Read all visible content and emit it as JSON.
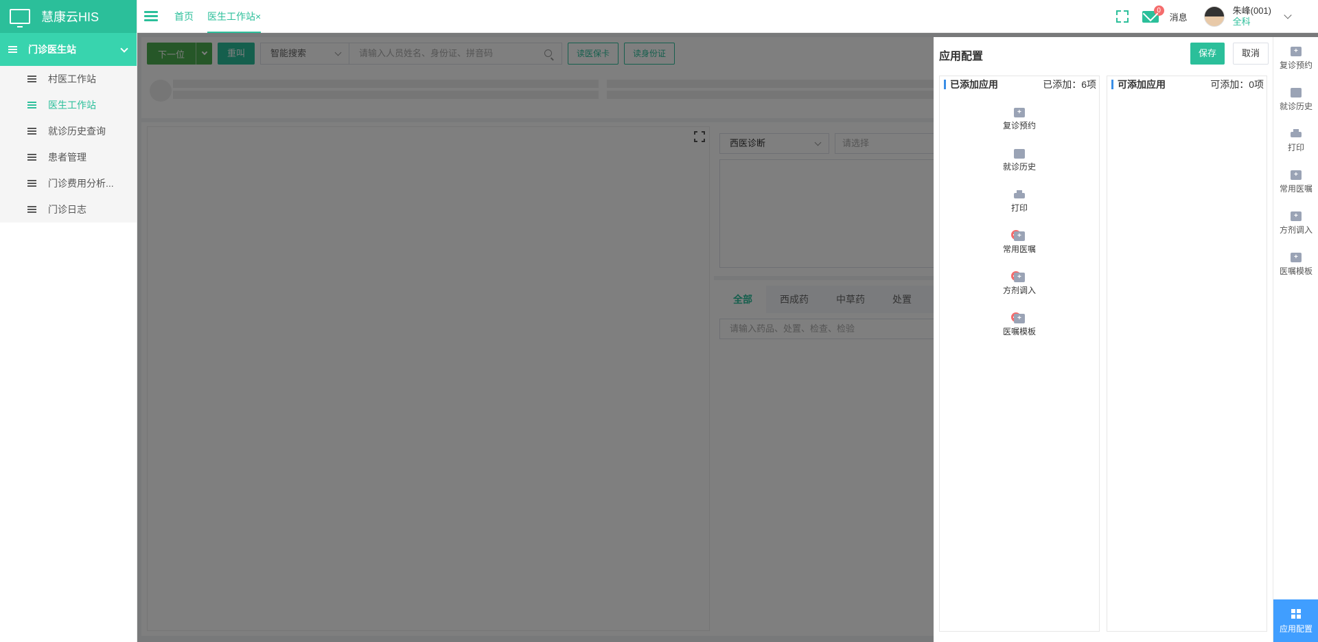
{
  "app": {
    "title": "慧康云HIS"
  },
  "sidebar": {
    "group_label": "门诊医生站",
    "items": [
      {
        "label": "村医工作站",
        "active": false
      },
      {
        "label": "医生工作站",
        "active": true
      },
      {
        "label": "就诊历史查询",
        "active": false
      },
      {
        "label": "患者管理",
        "active": false
      },
      {
        "label": "门诊费用分析...",
        "active": false
      },
      {
        "label": "门诊日志",
        "active": false
      }
    ]
  },
  "header": {
    "tabs": [
      {
        "label": "首页"
      },
      {
        "label": "医生工作站",
        "close": "×"
      }
    ],
    "message_badge": "0",
    "message_label": "消息",
    "user_name": "朱峰(001)",
    "user_dept": "全科"
  },
  "toolbar": {
    "next_label": "下一位",
    "recall_label": "重叫",
    "search_mode": "智能搜索",
    "search_placeholder": "请输入人员姓名、身份证、拼音码",
    "read_insurance_label": "读医保卡",
    "read_id_label": "读身份证"
  },
  "diagnosis": {
    "type": "西医诊断",
    "placeholder": "请选择"
  },
  "prescription": {
    "tabs": [
      "全部",
      "西成药",
      "中草药",
      "处置"
    ],
    "active_tab": "全部",
    "search_placeholder": "请输入药品、处置、检查、检验"
  },
  "config_drawer": {
    "title": "应用配置",
    "save_label": "保存",
    "cancel_label": "取消",
    "added": {
      "title": "已添加应用",
      "count_label": "已添加：6项",
      "items": [
        {
          "label": "复诊预约",
          "icon": "calendar-plus-icon",
          "removable": false
        },
        {
          "label": "就诊历史",
          "icon": "history-doc-icon",
          "removable": false
        },
        {
          "label": "打印",
          "icon": "printer-icon",
          "removable": false
        },
        {
          "label": "常用医嘱",
          "icon": "medkit-icon",
          "removable": true
        },
        {
          "label": "方剂调入",
          "icon": "import-icon",
          "removable": true
        },
        {
          "label": "医嘱模板",
          "icon": "template-icon",
          "removable": true
        }
      ]
    },
    "available": {
      "title": "可添加应用",
      "count_label": "可添加：0项"
    }
  },
  "right_rail": {
    "items": [
      "复诊预约",
      "就诊历史",
      "打印",
      "常用医嘱",
      "方剂调入",
      "医嘱模板"
    ],
    "config_label": "应用配置"
  },
  "colors": {
    "brand": "#2bbf9a",
    "group_bg": "#38d4ae",
    "next_button": "#4caf50",
    "accent_blue": "#409eff",
    "badge_red": "#f56c6c"
  }
}
